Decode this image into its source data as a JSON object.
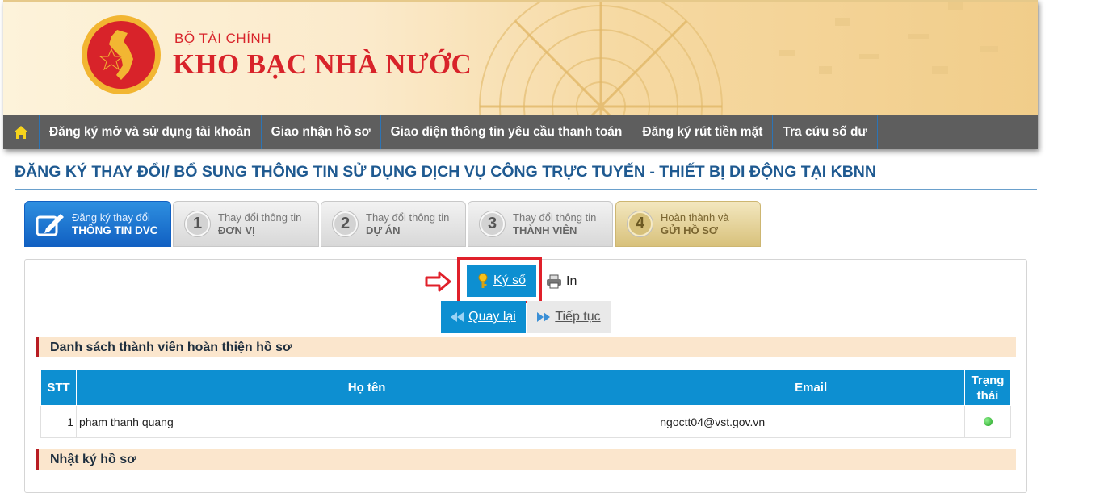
{
  "header": {
    "ministry": "BỘ TÀI CHÍNH",
    "agency": "KHO BẠC NHÀ NƯỚC"
  },
  "nav": {
    "items": [
      {
        "label": "Đăng ký mở và sử dụng tài khoản"
      },
      {
        "label": "Giao nhận hồ sơ"
      },
      {
        "label": "Giao diện thông tin yêu cầu thanh toán"
      },
      {
        "label": "Đăng ký rút tiền mặt"
      },
      {
        "label": "Tra cứu số dư"
      }
    ]
  },
  "page": {
    "title": "ĐĂNG KÝ THAY ĐỔI/ BỔ SUNG THÔNG TIN SỬ DỤNG DỊCH VỤ CÔNG TRỰC TUYẾN - THIẾT BỊ DI ĐỘNG TẠI KBNN"
  },
  "steps": [
    {
      "num": "",
      "line1": "Đăng ký thay đổi",
      "line2": "THÔNG TIN DVC"
    },
    {
      "num": "1",
      "line1": "Thay đổi thông tin",
      "line2": "ĐƠN VỊ"
    },
    {
      "num": "2",
      "line1": "Thay đổi thông tin",
      "line2": "DỰ ÁN"
    },
    {
      "num": "3",
      "line1": "Thay đổi thông tin",
      "line2": "THÀNH VIÊN"
    },
    {
      "num": "4",
      "line1": "Hoàn thành và",
      "line2": "GỬI HỒ SƠ"
    }
  ],
  "actions": {
    "sign": "Ký số",
    "print": "In",
    "back": "Quay lại",
    "next": "Tiếp tục"
  },
  "members": {
    "heading": "Danh sách thành viên hoàn thiện hồ sơ",
    "columns": [
      "STT",
      "Họ tên",
      "Email",
      "Trạng thái"
    ],
    "rows": [
      {
        "stt": "1",
        "name": "pham thanh quang",
        "email": "ngoctt04@vst.gov.vn",
        "status": "active"
      }
    ]
  },
  "log": {
    "heading": "Nhật ký hồ sơ"
  },
  "colors": {
    "primary": "#0d8fd1",
    "nav_bg": "#5e5e5e",
    "title": "#1f5a91",
    "highlight": "#e0202a",
    "section_bg": "#fbe6cd",
    "status_ok": "#1fa01f"
  }
}
